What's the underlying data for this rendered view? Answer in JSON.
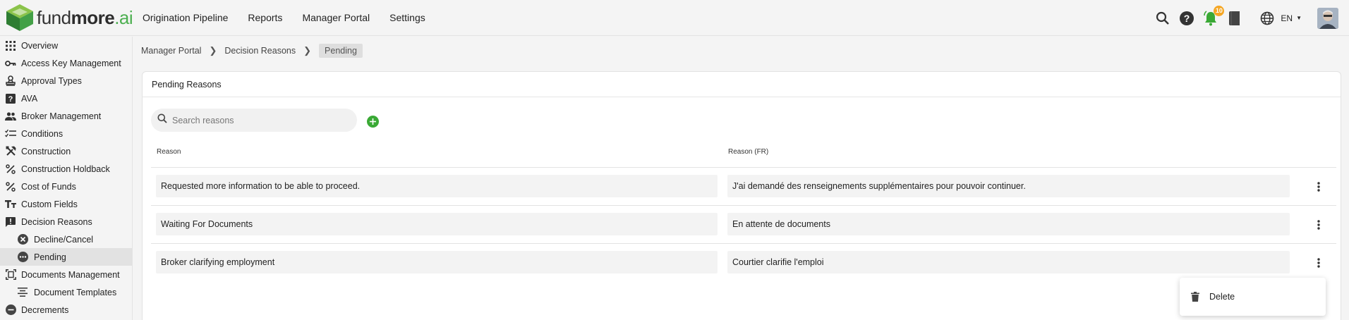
{
  "brand": {
    "part1": "fund",
    "part2": "more",
    "part3": ".ai"
  },
  "nav": [
    "Origination Pipeline",
    "Reports",
    "Manager Portal",
    "Settings"
  ],
  "top_right": {
    "notification_count": "10",
    "language": "EN"
  },
  "sidebar": {
    "items": [
      {
        "label": "Overview",
        "icon": "grid-icon"
      },
      {
        "label": "Access Key Management",
        "icon": "key-icon"
      },
      {
        "label": "Approval Types",
        "icon": "stamp-icon"
      },
      {
        "label": "AVA",
        "icon": "help-box-icon"
      },
      {
        "label": "Broker Management",
        "icon": "people-icon"
      },
      {
        "label": "Conditions",
        "icon": "checklist-icon"
      },
      {
        "label": "Construction",
        "icon": "tools-icon"
      },
      {
        "label": "Construction Holdback",
        "icon": "percent-icon"
      },
      {
        "label": "Cost of Funds",
        "icon": "percent-icon"
      },
      {
        "label": "Custom Fields",
        "icon": "text-format-icon"
      },
      {
        "label": "Decision Reasons",
        "icon": "alert-message-icon"
      },
      {
        "label": "Decline/Cancel",
        "icon": "cancel-circle-icon",
        "sub": true
      },
      {
        "label": "Pending",
        "icon": "pending-circle-icon",
        "sub": true,
        "active": true
      },
      {
        "label": "Documents Management",
        "icon": "document-scan-icon"
      },
      {
        "label": "Document Templates",
        "icon": "align-center-icon",
        "sub": true
      },
      {
        "label": "Decrements",
        "icon": "minus-circle-icon"
      }
    ]
  },
  "breadcrumb": [
    "Manager Portal",
    "Decision Reasons",
    "Pending"
  ],
  "card": {
    "title": "Pending Reasons",
    "search_placeholder": "Search reasons",
    "columns": [
      "Reason",
      "Reason (FR)"
    ],
    "rows": [
      {
        "reason": "Requested more information to be able to proceed.",
        "reason_fr": "J'ai demandé des renseignements supplémentaires pour pouvoir continuer."
      },
      {
        "reason": "Waiting For Documents",
        "reason_fr": "En attente de documents"
      },
      {
        "reason": "Broker clarifying employment",
        "reason_fr": "Courtier clarifie l'emploi"
      }
    ]
  },
  "context_menu": {
    "delete_label": "Delete"
  },
  "colors": {
    "accent_green": "#3aa935",
    "badge_orange": "#f5a623",
    "logo_green": "#4caf50"
  }
}
